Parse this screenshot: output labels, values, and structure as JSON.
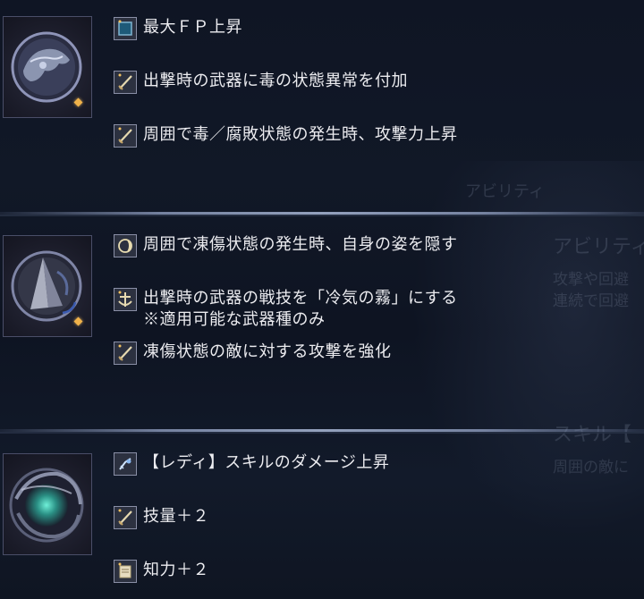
{
  "sections": [
    {
      "effects": [
        {
          "text": "最大ＦＰ上昇",
          "icon": "fp-square-icon"
        },
        {
          "text": "出撃時の武器に毒の状態異常を付加",
          "icon": "sword-icon"
        },
        {
          "text": "周囲で毒／腐敗状態の発生時、攻撃力上昇",
          "icon": "sword-icon"
        }
      ]
    },
    {
      "effects": [
        {
          "text": "周囲で凍傷状態の発生時、自身の姿を隠す",
          "icon": "crescent-icon"
        },
        {
          "text": "出撃時の武器の戦技を「冷気の霧」にする",
          "note": "※適用可能な武器種のみ",
          "icon": "anchor-skill-icon"
        },
        {
          "text": "凍傷状態の敵に対する攻撃を強化",
          "icon": "sword-icon"
        }
      ]
    },
    {
      "effects": [
        {
          "text": "【レディ】スキルのダメージ上昇",
          "icon": "character-skill-icon"
        },
        {
          "text": "技量＋２",
          "icon": "sword-icon"
        },
        {
          "text": "知力＋２",
          "icon": "scroll-icon"
        }
      ]
    }
  ],
  "background": {
    "ghost_texts": [
      "アビリティ",
      "アビリティ",
      "攻撃や回避",
      "連続で回避",
      "スキル【",
      "周囲の敵に"
    ]
  },
  "colors": {
    "accent_diamond": "#f0b24a",
    "divider": "#aab6d6",
    "text": "#ececf0"
  }
}
